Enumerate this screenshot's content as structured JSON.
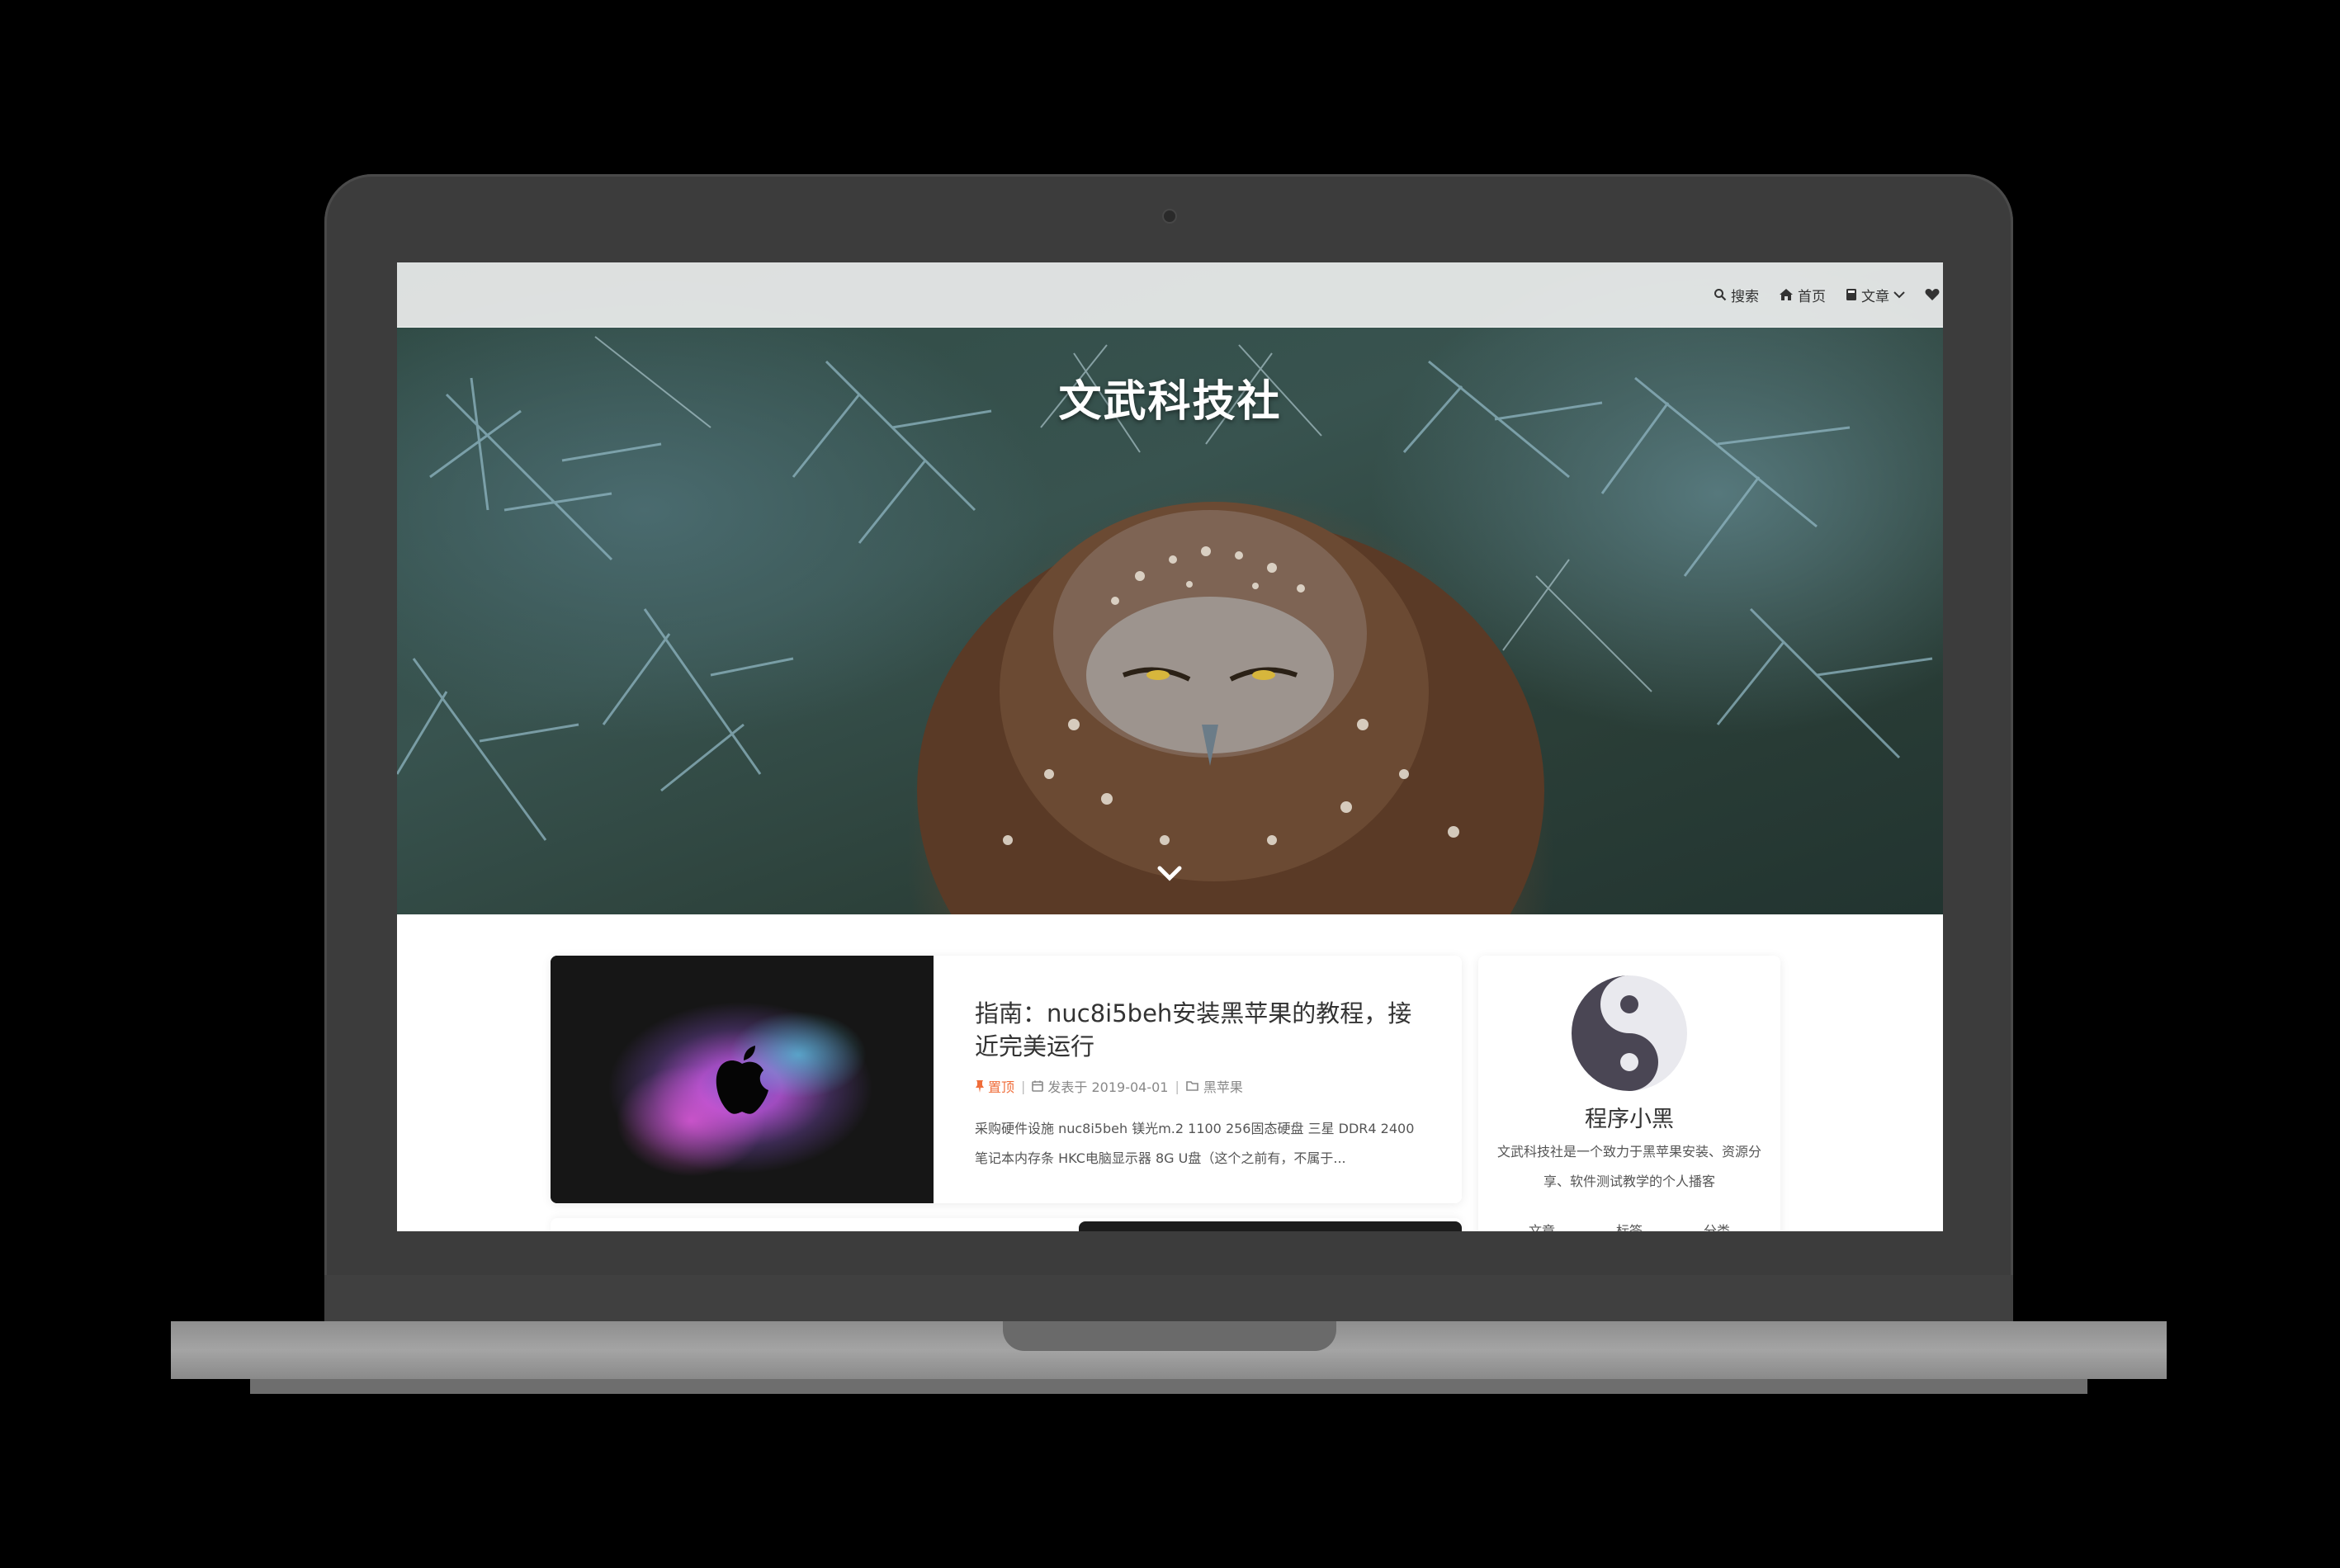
{
  "site": {
    "title": "文武科技社"
  },
  "nav": {
    "items": [
      {
        "label": "搜索",
        "icon": "search-icon"
      },
      {
        "label": "首页",
        "icon": "home-icon"
      },
      {
        "label": "文章",
        "icon": "book-icon",
        "dropdown": true
      },
      {
        "label": "",
        "icon": "heart-icon"
      }
    ]
  },
  "post": {
    "title": "指南：nuc8i5beh安装黑苹果的教程，接近完美运行",
    "pinned_label": "置顶",
    "date_label": "发表于 2019-04-01",
    "category": "黑苹果",
    "excerpt": "采购硬件设施 nuc8i5beh 镁光m.2 1100 256固态硬盘 三星 DDR4 2400笔记本内存条 HKC电脑显示器 8G U盘（这个之前有，不属于..."
  },
  "profile": {
    "name": "程序小黑",
    "description": "文武科技社是一个致力于黑苹果安装、资源分享、软件测试教学的个人播客",
    "stats": [
      "文章",
      "标签",
      "分类"
    ]
  },
  "colors": {
    "accent": "#f06d3a",
    "navbar": "#f5f5f5",
    "laptop_frame": "#3c3c3c"
  }
}
